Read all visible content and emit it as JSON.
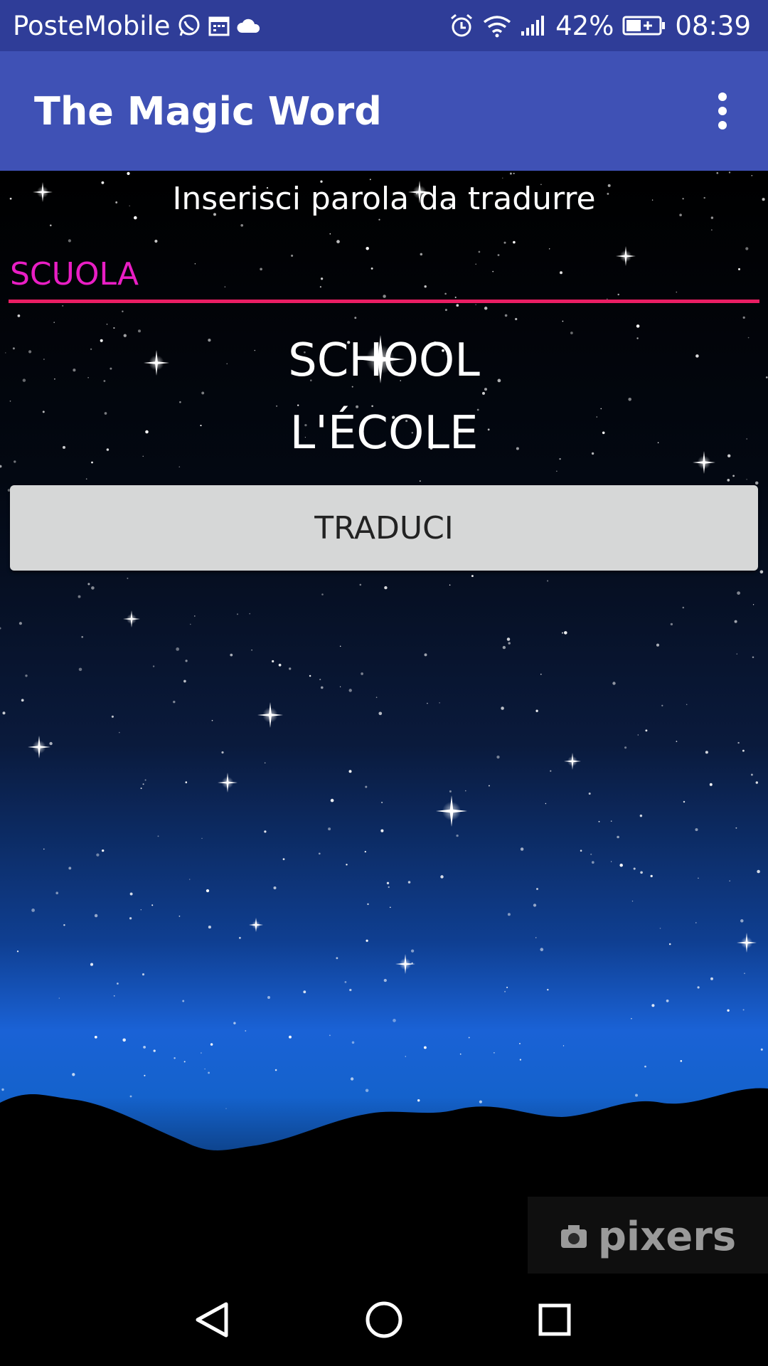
{
  "status_bar": {
    "carrier": "PosteMobile",
    "battery_percent": "42%",
    "time": "08:39",
    "icons": [
      "whatsapp-icon",
      "calendar-icon",
      "cloud-icon",
      "alarm-icon",
      "wifi-icon",
      "signal-icon",
      "battery-charging-icon"
    ]
  },
  "app_bar": {
    "title": "The Magic Word",
    "menu_icon": "overflow-menu-icon"
  },
  "main": {
    "prompt": "Inserisci parola da tradurre",
    "input_value": "SCUOLA",
    "translation_en": "SCHOOL",
    "translation_fr": "L'ÉCOLE",
    "translate_button": "TRADUCI",
    "watermark": "pixers"
  },
  "nav_bar": {
    "back": "back-icon",
    "home": "home-icon",
    "recents": "recents-icon"
  },
  "colors": {
    "status_bar": "#2f3d98",
    "app_bar": "#3f51b5",
    "input_underline": "#e91e63",
    "input_text": "#e91ec4",
    "button": "#d6d7d7"
  }
}
